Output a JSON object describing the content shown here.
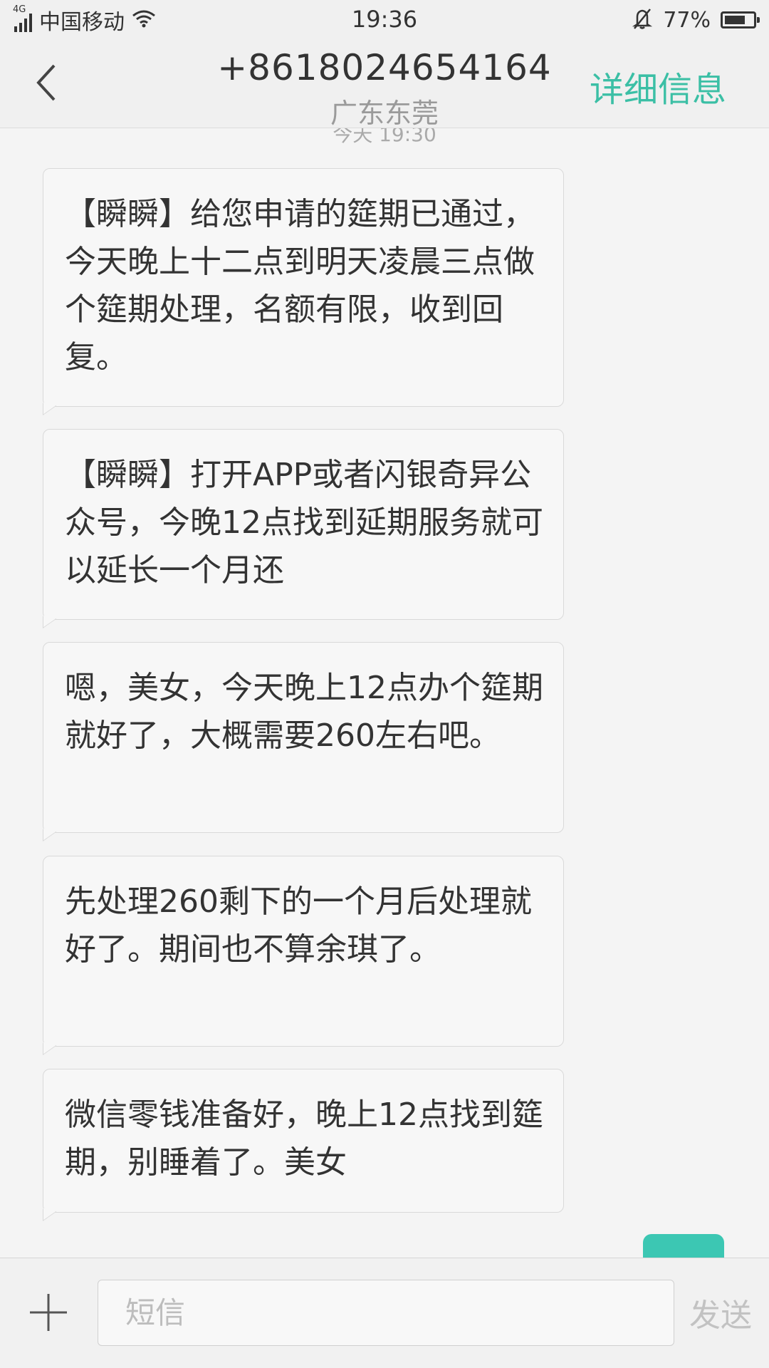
{
  "status_bar": {
    "network": "4G",
    "carrier": "中国移动",
    "time": "19:36",
    "battery_text": "77%",
    "battery_level": 0.77,
    "icons": [
      "signal-icon",
      "wifi-icon",
      "mute-bell-icon",
      "battery-icon"
    ]
  },
  "header": {
    "title": "+8618024654164",
    "subtitle": "广东东莞",
    "details_label": "详细信息",
    "accent_color": "#3bbfa5",
    "back_icon": "chevron-left-icon"
  },
  "conversation": {
    "timestamp": "今天 19:30",
    "messages": [
      {
        "direction": "received",
        "text": "【瞬瞬】给您申请的筵期已通过，今天晚上十二点到明天凌晨三点做个筵期处理，名额有限，收到回复。"
      },
      {
        "direction": "received",
        "text": "【瞬瞬】打开APP或者闪银奇异公众号，今晚12点找到延期服务就可以延长一个月还"
      },
      {
        "direction": "received",
        "text": "嗯，美女，今天晚上12点办个筵期就好了，大概需要260左右吧。"
      },
      {
        "direction": "received",
        "text": "先处理260剩下的一个月后处理就好了。期间也不算余琪了。"
      },
      {
        "direction": "received",
        "text": "微信零钱准备好，晚上12点找到筵期，别睡着了。美女"
      }
    ],
    "sent_bubble_color": "#3cc7b3"
  },
  "input_bar": {
    "placeholder": "短信",
    "value": "",
    "send_label": "发送",
    "plus_icon": "plus-icon"
  }
}
